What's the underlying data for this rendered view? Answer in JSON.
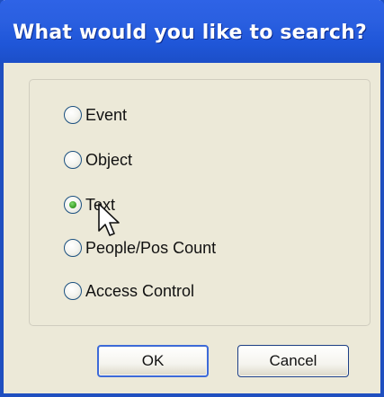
{
  "dialog": {
    "title": "What would you like to search?"
  },
  "options": [
    {
      "label": "Event",
      "checked": false
    },
    {
      "label": "Object",
      "checked": false
    },
    {
      "label": "Text",
      "checked": true
    },
    {
      "label": "People/Pos Count",
      "checked": false
    },
    {
      "label": "Access Control",
      "checked": false
    }
  ],
  "buttons": {
    "ok_label": "OK",
    "cancel_label": "Cancel"
  },
  "colors": {
    "titlebar": "#2458d8",
    "title_text": "#ffffff",
    "dialog_background": "#ece9d8",
    "radio_selected": "#3ea12a",
    "default_button_border": "#3d6ad8"
  },
  "icons": {
    "cursor": "arrow-cursor-icon",
    "radio_dot": "radio-selected-dot-icon"
  }
}
